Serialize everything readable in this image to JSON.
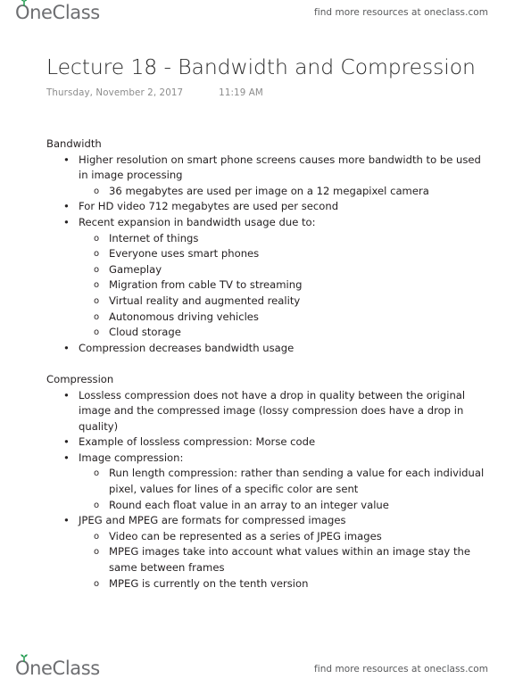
{
  "header": {
    "logo_text": "OneClass",
    "logo_icon": "oneclass-sprout-logo",
    "tagline": "find more resources at oneclass.com"
  },
  "footer": {
    "logo_text": "OneClass",
    "logo_icon": "oneclass-sprout-logo",
    "tagline": "find more resources at oneclass.com"
  },
  "document": {
    "title": "Lecture 18 - Bandwidth and Compression",
    "date": "Thursday, November 2, 2017",
    "time": "11:19 AM"
  },
  "colors": {
    "brand_green": "#1f9a4d",
    "brand_gray": "#6d6e71",
    "body_text": "#231f20",
    "subtitle_gray": "#8c8c8c",
    "page_background": "#ffffff"
  },
  "notes": {
    "sections": [
      {
        "heading": "Bandwidth",
        "items": [
          {
            "level": 1,
            "marker": "•",
            "text": "Higher resolution on smart phone screens causes more bandwidth to be used in image processing"
          },
          {
            "level": 2,
            "marker": "o",
            "text": "36 megabytes are used per image on a 12 megapixel camera"
          },
          {
            "level": 1,
            "marker": "•",
            "text": "For HD video 712 megabytes are used per second"
          },
          {
            "level": 1,
            "marker": "•",
            "text": "Recent expansion in bandwidth usage due to:"
          },
          {
            "level": 2,
            "marker": "o",
            "text": "Internet of things"
          },
          {
            "level": 2,
            "marker": "o",
            "text": "Everyone uses smart phones"
          },
          {
            "level": 2,
            "marker": "o",
            "text": "Gameplay"
          },
          {
            "level": 2,
            "marker": "o",
            "text": "Migration from cable TV to streaming"
          },
          {
            "level": 2,
            "marker": "o",
            "text": "Virtual reality and augmented reality"
          },
          {
            "level": 2,
            "marker": "o",
            "text": "Autonomous driving vehicles"
          },
          {
            "level": 2,
            "marker": "o",
            "text": "Cloud storage"
          },
          {
            "level": 1,
            "marker": "•",
            "text": "Compression decreases bandwidth usage"
          }
        ]
      },
      {
        "heading": "Compression",
        "items": [
          {
            "level": 1,
            "marker": "•",
            "text": "Lossless compression does not have a drop in quality between the original image and the compressed image (lossy compression does have a drop in quality)"
          },
          {
            "level": 1,
            "marker": "•",
            "text": "Example of lossless compression: Morse code"
          },
          {
            "level": 1,
            "marker": "•",
            "text": "Image compression:"
          },
          {
            "level": 2,
            "marker": "o",
            "text": "Run length compression: rather than sending a value for each individual pixel, values for lines of a specific color are sent"
          },
          {
            "level": 2,
            "marker": "o",
            "text": "Round each float value in an array to an integer value"
          },
          {
            "level": 1,
            "marker": "•",
            "text": "JPEG and MPEG are formats for compressed images"
          },
          {
            "level": 2,
            "marker": "o",
            "text": "Video can be represented as a series of JPEG images"
          },
          {
            "level": 2,
            "marker": "o",
            "text": "MPEG images take into account what values within an image stay the same between frames"
          },
          {
            "level": 2,
            "marker": "o",
            "text": "MPEG is currently on the tenth version"
          }
        ]
      }
    ]
  }
}
